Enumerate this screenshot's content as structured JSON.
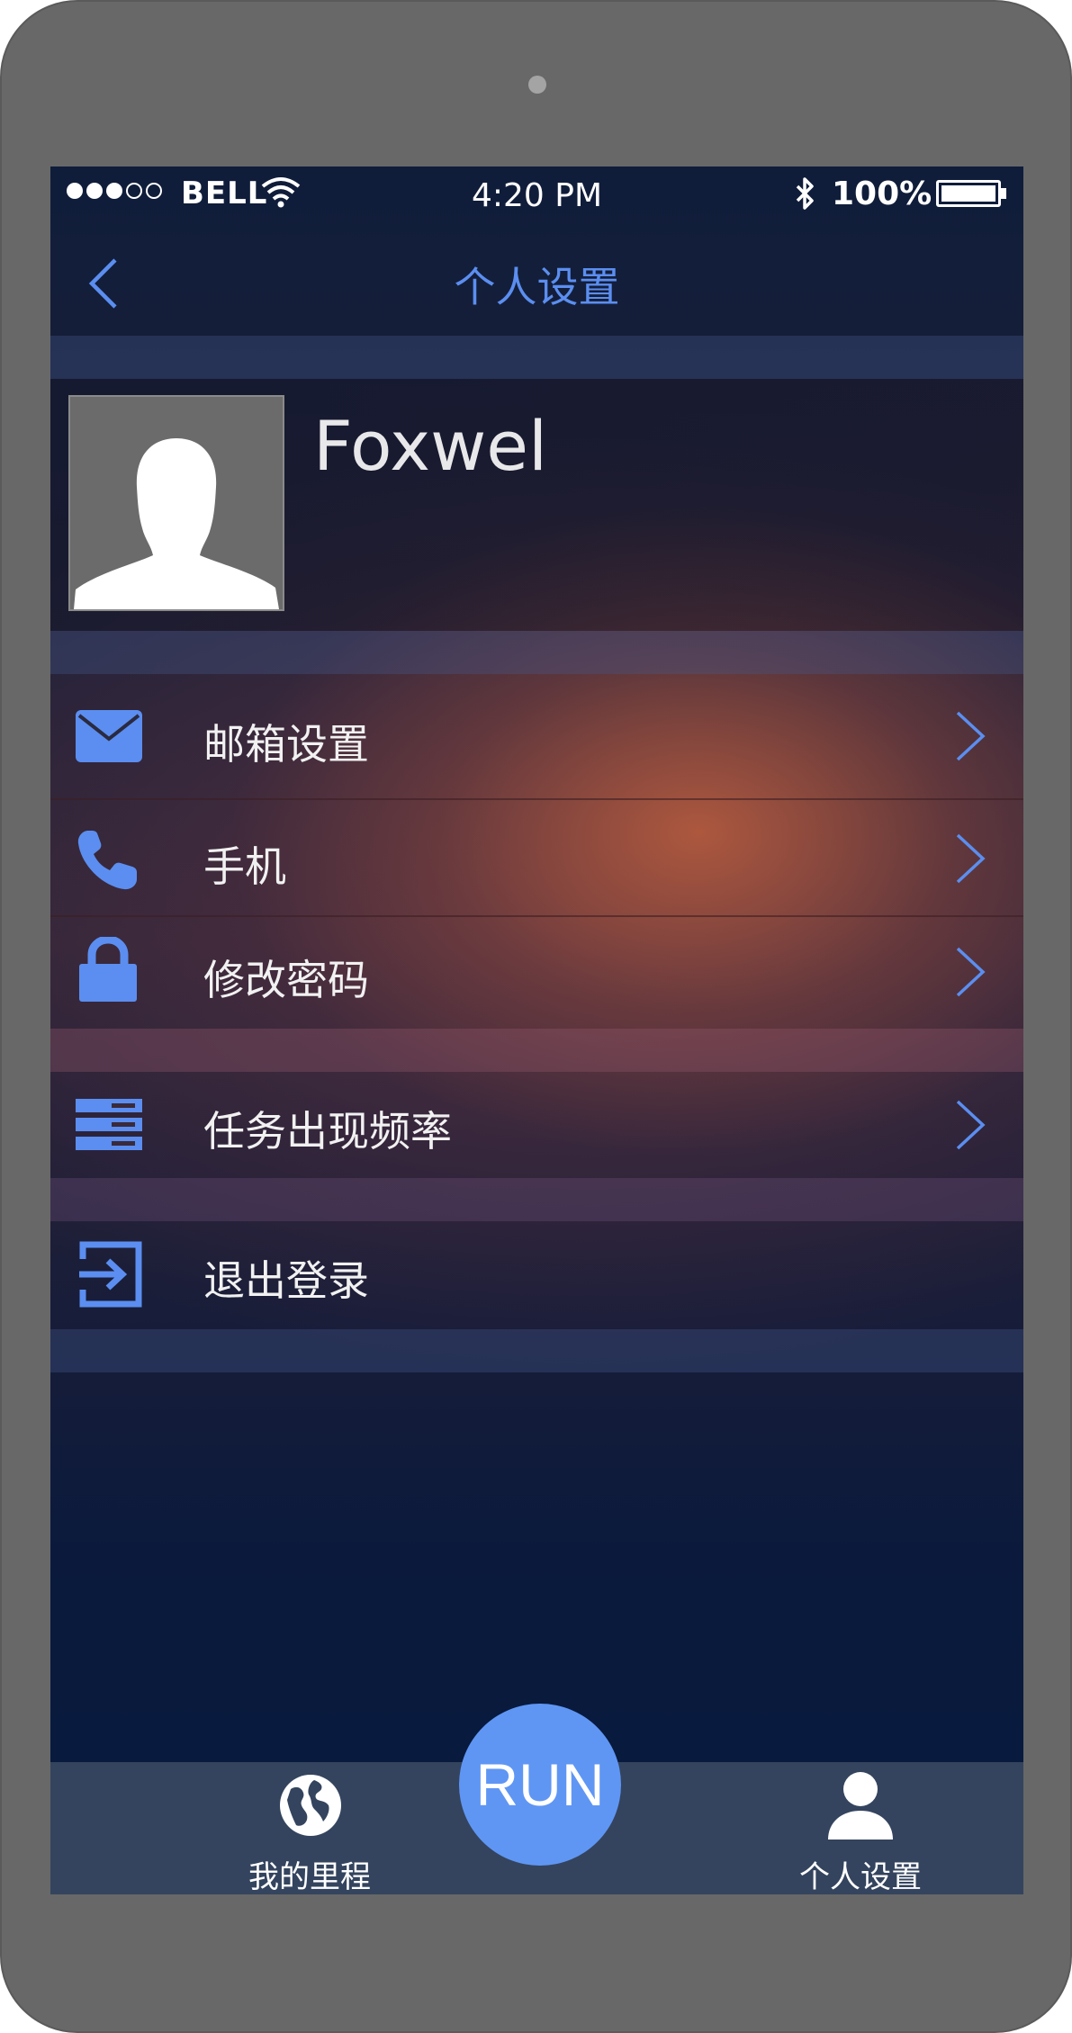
{
  "status_bar": {
    "carrier": "BELL",
    "time": "4:20 PM",
    "battery": "100%",
    "signal_icon": "signal-dots-icon",
    "wifi_icon": "wifi-icon",
    "bluetooth_icon": "bluetooth-icon",
    "battery_icon": "battery-icon"
  },
  "navbar": {
    "title": "个人设置",
    "back_icon": "chevron-left-icon"
  },
  "profile": {
    "name": "Foxwel",
    "avatar_icon": "person-silhouette-icon"
  },
  "settings": {
    "email": {
      "label": "邮箱设置",
      "icon": "envelope-icon"
    },
    "phone": {
      "label": "手机",
      "icon": "phone-icon"
    },
    "password": {
      "label": "修改密码",
      "icon": "lock-icon"
    },
    "frequency": {
      "label": "任务出现频率",
      "icon": "server-stack-icon"
    },
    "logout": {
      "label": "退出登录",
      "icon": "sign-out-icon"
    }
  },
  "tabbar": {
    "milestones": {
      "label": "我的里程",
      "icon": "globe-icon"
    },
    "run": {
      "label": "RUN"
    },
    "settings": {
      "label": "个人设置",
      "icon": "user-icon"
    }
  },
  "colors": {
    "accent": "#5b8ef0",
    "tabbar_bg": "#34445e",
    "run_button": "#5f96f4",
    "device_frame": "#686868"
  }
}
